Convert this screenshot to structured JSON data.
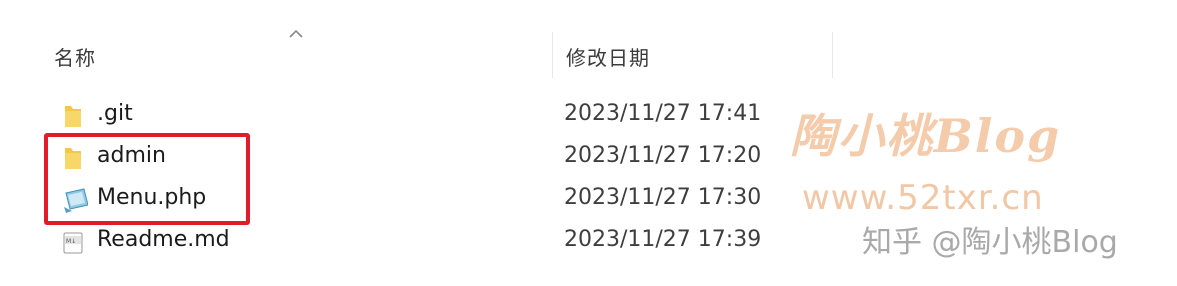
{
  "header": {
    "name_label": "名称",
    "date_label": "修改日期"
  },
  "files": [
    {
      "name": ".git",
      "date": "2023/11/27 17:41",
      "icon": "folder-icon"
    },
    {
      "name": "admin",
      "date": "2023/11/27 17:20",
      "icon": "folder-icon"
    },
    {
      "name": "Menu.php",
      "date": "2023/11/27 17:30",
      "icon": "php-file-icon"
    },
    {
      "name": "Readme.md",
      "date": "2023/11/27 17:39",
      "icon": "markdown-file-icon"
    }
  ],
  "watermark": {
    "blog": "陶小桃Blog",
    "url": "www.52txr.cn",
    "zhihu": "知乎 @陶小桃Blog"
  },
  "colors": {
    "highlight": "#e01b2a",
    "folder": "#f2c84b",
    "watermark_orange": "#f1c7a6"
  }
}
